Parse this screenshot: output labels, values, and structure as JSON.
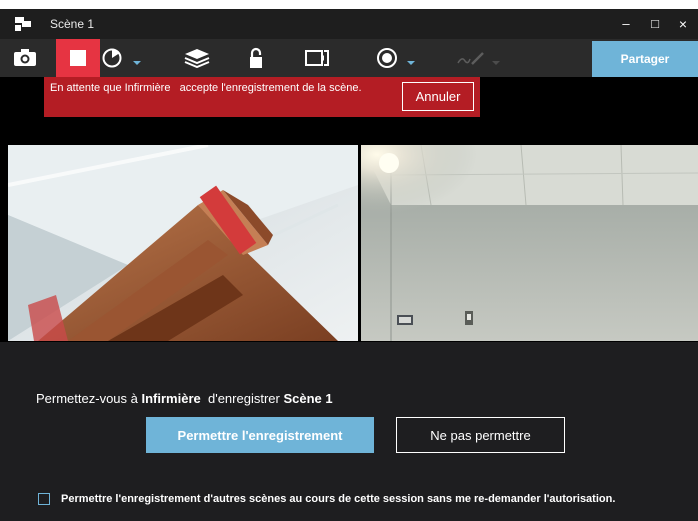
{
  "window": {
    "title": "Scène 1",
    "minimize_glyph": "–",
    "maximize_glyph": "□",
    "close_glyph": "×"
  },
  "toolbar": {
    "icons": [
      "camera-icon",
      "stop-record-icon",
      "timer-icon",
      "layers-icon",
      "lock-icon",
      "frame-icon",
      "record-circle-icon",
      "pen-icon"
    ],
    "share_label": "Partager",
    "accent": "#6fb4d8",
    "stop_color": "#e63442"
  },
  "waiting": {
    "prefix": "En attente que",
    "user": "Infirmière",
    "suffix": "accepte l'enregistrement de la scène.",
    "cancel_label": "Annuler",
    "color": "#b41d24"
  },
  "permission": {
    "prefix": "Permettez-vous à",
    "user": "Infirmière",
    "middle": "d'enregistrer",
    "scene": "Scène 1",
    "allow_label": "Permettre l'enregistrement",
    "deny_label": "Ne pas permettre",
    "always_label": "Permettre l'enregistrement d'autres scènes au cours de cette session sans me re-demander l'autorisation.",
    "always_checked": false
  }
}
